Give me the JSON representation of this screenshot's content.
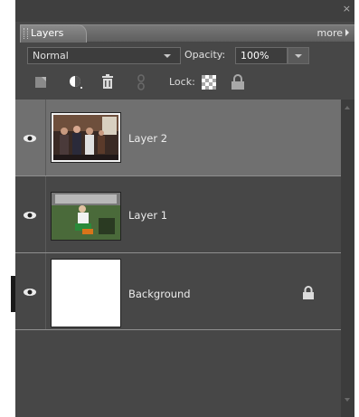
{
  "panel": {
    "close_glyph": "×",
    "tab_label": "Layers",
    "more_label": "more"
  },
  "controls": {
    "blend_mode": "Normal",
    "opacity_label": "Opacity:",
    "opacity_value": "100%",
    "lock_label": "Lock:"
  },
  "icons": [
    "close-icon",
    "new-layer-icon",
    "adjustment-layer-icon",
    "trash-icon",
    "link-icon",
    "lock-transparent-icon",
    "lock-all-icon",
    "eye-icon",
    "lock-icon",
    "scroll-up-icon",
    "scroll-down-icon"
  ],
  "layers": [
    {
      "name": "Layer 2",
      "selected": true,
      "visible": true,
      "locked": false
    },
    {
      "name": "Layer 1",
      "selected": false,
      "visible": true,
      "locked": false
    },
    {
      "name": "Background",
      "selected": false,
      "visible": true,
      "locked": true
    }
  ],
  "colors": {
    "panel_bg": "#474747",
    "selected_row": "#707070",
    "row_divider": "#8f8f8f"
  }
}
